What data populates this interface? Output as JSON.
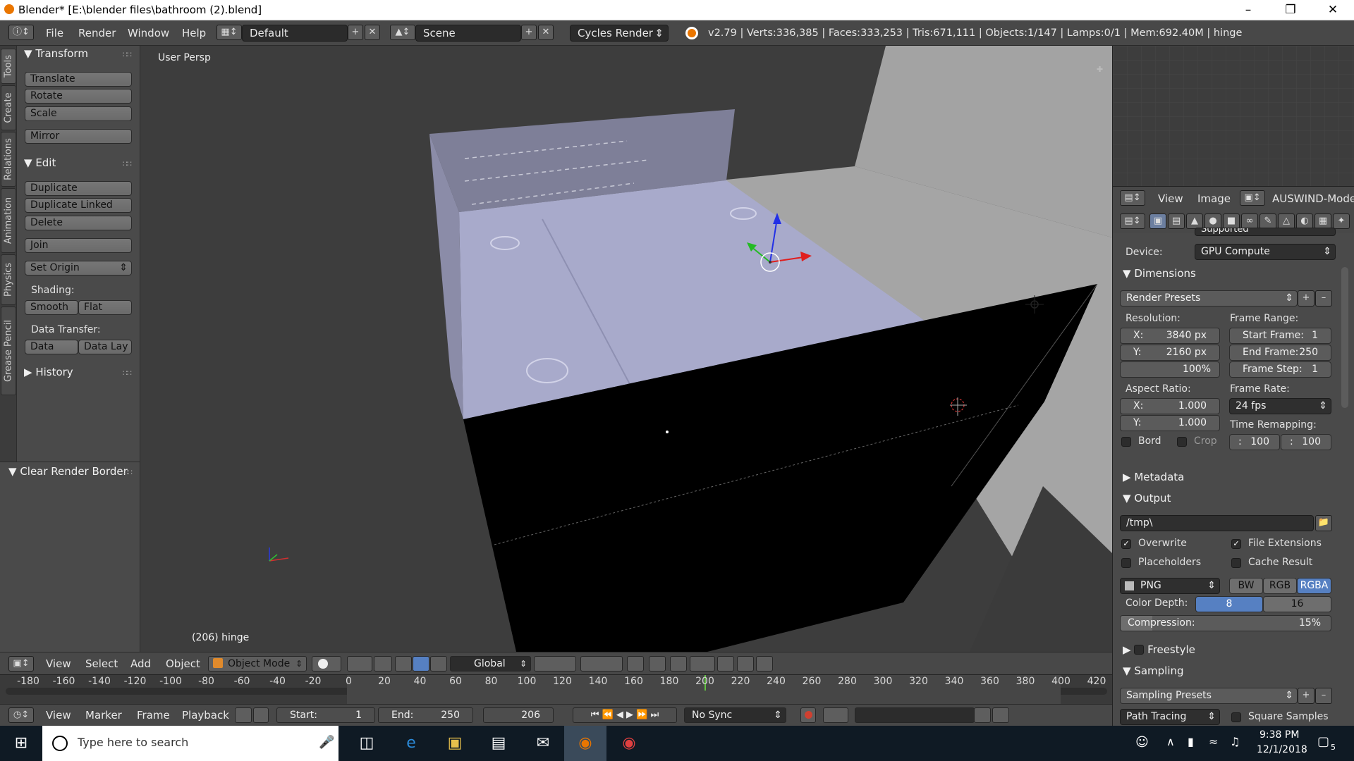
{
  "window": {
    "title": "Blender* [E:\\blender files\\bathroom (2).blend]"
  },
  "infobar": {
    "menus": [
      "File",
      "Render",
      "Window",
      "Help"
    ],
    "screen_layout": "Default",
    "scene": "Scene",
    "engine": "Cycles Render",
    "stats": "v2.79 | Verts:336,385 | Faces:333,253 | Tris:671,111 | Objects:1/147 | Lamps:0/1 | Mem:692.40M | hinge"
  },
  "tabs": [
    "Tools",
    "Create",
    "Relations",
    "Animation",
    "Physics",
    "Grease Pencil"
  ],
  "tools": {
    "transform_header": "Transform",
    "translate": "Translate",
    "rotate": "Rotate",
    "scale": "Scale",
    "mirror": "Mirror",
    "edit_header": "Edit",
    "duplicate": "Duplicate",
    "duplicate_linked": "Duplicate Linked",
    "delete": "Delete",
    "join": "Join",
    "set_origin": "Set Origin",
    "shading_label": "Shading:",
    "smooth": "Smooth",
    "flat": "Flat",
    "data_transfer_label": "Data Transfer:",
    "data": "Data",
    "data_lay": "Data Lay",
    "history_header": "History"
  },
  "last_operator": {
    "header": "Clear Render Border"
  },
  "viewport": {
    "view_label": "User Persp",
    "object_label": "(206) hinge"
  },
  "vp_header": {
    "menus": [
      "View",
      "Select",
      "Add",
      "Object"
    ],
    "mode": "Object Mode",
    "orientation": "Global"
  },
  "timeline": {
    "ticks": [
      "-180",
      "-160",
      "-140",
      "-120",
      "-100",
      "-80",
      "-60",
      "-40",
      "-20",
      "0",
      "20",
      "40",
      "60",
      "80",
      "100",
      "120",
      "140",
      "160",
      "180",
      "200",
      "220",
      "240",
      "260",
      "280",
      "300",
      "320",
      "340",
      "360",
      "380",
      "400",
      "420"
    ],
    "current_frame": 206
  },
  "tl_header": {
    "menus": [
      "View",
      "Marker",
      "Frame",
      "Playback"
    ],
    "start_label": "Start:",
    "start_value": "1",
    "end_label": "End:",
    "end_value": "250",
    "frame": "206",
    "sync": "No Sync"
  },
  "image_header": {
    "view": "View",
    "image": "Image",
    "image_name": "AUSWIND-Modern"
  },
  "properties": {
    "feature_set_value": "Supported",
    "device_label": "Device:",
    "device_value": "GPU Compute",
    "dimensions_header": "Dimensions",
    "render_presets": "Render Presets",
    "resolution_label": "Resolution:",
    "res_x_label": "X:",
    "res_x": "3840 px",
    "res_y_label": "Y:",
    "res_y": "2160 px",
    "res_pct": "100%",
    "frame_range_label": "Frame Range:",
    "start_frame_label": "Start Frame:",
    "start_frame": "1",
    "end_frame_label": "End Frame:",
    "end_frame": "250",
    "frame_step_label": "Frame Step:",
    "frame_step": "1",
    "aspect_label": "Aspect Ratio:",
    "aspect_x_label": "X:",
    "aspect_x": "1.000",
    "aspect_y_label": "Y:",
    "aspect_y": "1.000",
    "frame_rate_label": "Frame Rate:",
    "frame_rate": "24 fps",
    "time_remap_label": "Time Remapping:",
    "remap_old": "100",
    "remap_new": "100",
    "bord": "Bord",
    "crop": "Crop",
    "metadata_header": "Metadata",
    "output_header": "Output",
    "output_path": "/tmp\\",
    "overwrite": "Overwrite",
    "file_ext": "File Extensions",
    "placeholders": "Placeholders",
    "cache_result": "Cache Result",
    "format": "PNG",
    "bw": "BW",
    "rgb": "RGB",
    "rgba": "RGBA",
    "color_depth_label": "Color Depth:",
    "depth_8": "8",
    "depth_16": "16",
    "compression_label": "Compression:",
    "compression": "15%",
    "freestyle_header": "Freestyle",
    "sampling_header": "Sampling",
    "sampling_presets": "Sampling Presets",
    "path_tracing": "Path Tracing",
    "square_samples": "Square Samples"
  },
  "taskbar": {
    "search_placeholder": "Type here to search",
    "time": "9:38 PM",
    "date": "12/1/2018",
    "notifications": "5"
  }
}
